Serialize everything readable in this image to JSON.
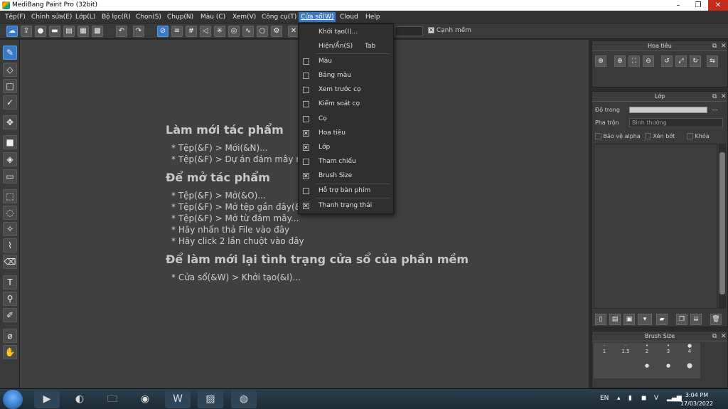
{
  "window": {
    "title": "MediBang Paint Pro (32bit)",
    "minimize": "–",
    "restore": "❐",
    "close": "✕"
  },
  "menu": {
    "items": [
      "Tệp(F)",
      "Chỉnh sửa(E)",
      "Lớp(L)",
      "Bộ lọc(R)",
      "Chọn(S)",
      "Chụp(N)",
      "Màu (C)",
      "Xem(V)",
      "Công cụ(T)",
      "Cửa sổ(W)",
      "Cloud",
      "Help"
    ],
    "active": "Cửa sổ(W)"
  },
  "toolbar": {
    "edge_label": "Cạnh mềm"
  },
  "dropdown": {
    "items": [
      {
        "label": "Khởi tạo(I)...",
        "shortcut": "",
        "checkbox": false,
        "checked": false
      },
      {
        "label": "Hiện/Ẩn(S)",
        "shortcut": "Tab",
        "checkbox": false,
        "checked": false
      },
      {
        "label": "Màu",
        "shortcut": "",
        "checkbox": true,
        "checked": false
      },
      {
        "label": "Bảng màu",
        "shortcut": "",
        "checkbox": true,
        "checked": false
      },
      {
        "label": "Xem trước cọ",
        "shortcut": "",
        "checkbox": true,
        "checked": false
      },
      {
        "label": "Kiểm soát cọ",
        "shortcut": "",
        "checkbox": true,
        "checked": false
      },
      {
        "label": "Cọ",
        "shortcut": "",
        "checkbox": true,
        "checked": false
      },
      {
        "label": "Hoa tiêu",
        "shortcut": "",
        "checkbox": true,
        "checked": true
      },
      {
        "label": "Lớp",
        "shortcut": "",
        "checkbox": true,
        "checked": true
      },
      {
        "label": "Tham chiếu",
        "shortcut": "",
        "checkbox": true,
        "checked": false
      },
      {
        "label": "Brush Size",
        "shortcut": "",
        "checkbox": true,
        "checked": true
      },
      {
        "label": "Hỗ trợ bàn phím",
        "shortcut": "",
        "checkbox": true,
        "checked": false
      },
      {
        "label": "Thanh trạng thái",
        "shortcut": "",
        "checkbox": true,
        "checked": true
      }
    ]
  },
  "welcome": {
    "new_heading": "Làm mới tác phẩm",
    "new_items": [
      "* Tệp(&F) > Mới(&N)...",
      "* Tệp(&F) > Dự án đám mây mới..."
    ],
    "open_heading": "Để mở tác phẩm",
    "open_items": [
      "* Tệp(&F) > Mở(&O)...",
      "* Tệp(&F) > Mở tệp gần đây(&R)",
      "* Tệp(&F) > Mở từ đám mây...",
      "* Hãy nhấn thả File vào đây",
      "* Hãy click 2 lần chuột vào đây"
    ],
    "reset_heading": "Để làm mới lại tình trạng cửa sổ của phần mềm",
    "reset_items": [
      "* Cửa sổ(&W) > Khởi tạo(&I)..."
    ]
  },
  "navigator": {
    "title": "Hoa tiêu"
  },
  "layer": {
    "title": "Lớp",
    "opacity_label": "Độ trong",
    "opacity_value": "---",
    "blend_label": "Pha trộn",
    "blend_value": "Bình thường",
    "protect_alpha": "Bảo vệ alpha",
    "clipping": "Xén bớt",
    "lock": "Khóa"
  },
  "brush_size": {
    "title": "Brush Size",
    "sizes": [
      "1",
      "1.5",
      "2",
      "3",
      "4"
    ]
  },
  "taskbar": {
    "lang": "EN",
    "time": "3:04 PM",
    "date": "17/03/2022"
  }
}
